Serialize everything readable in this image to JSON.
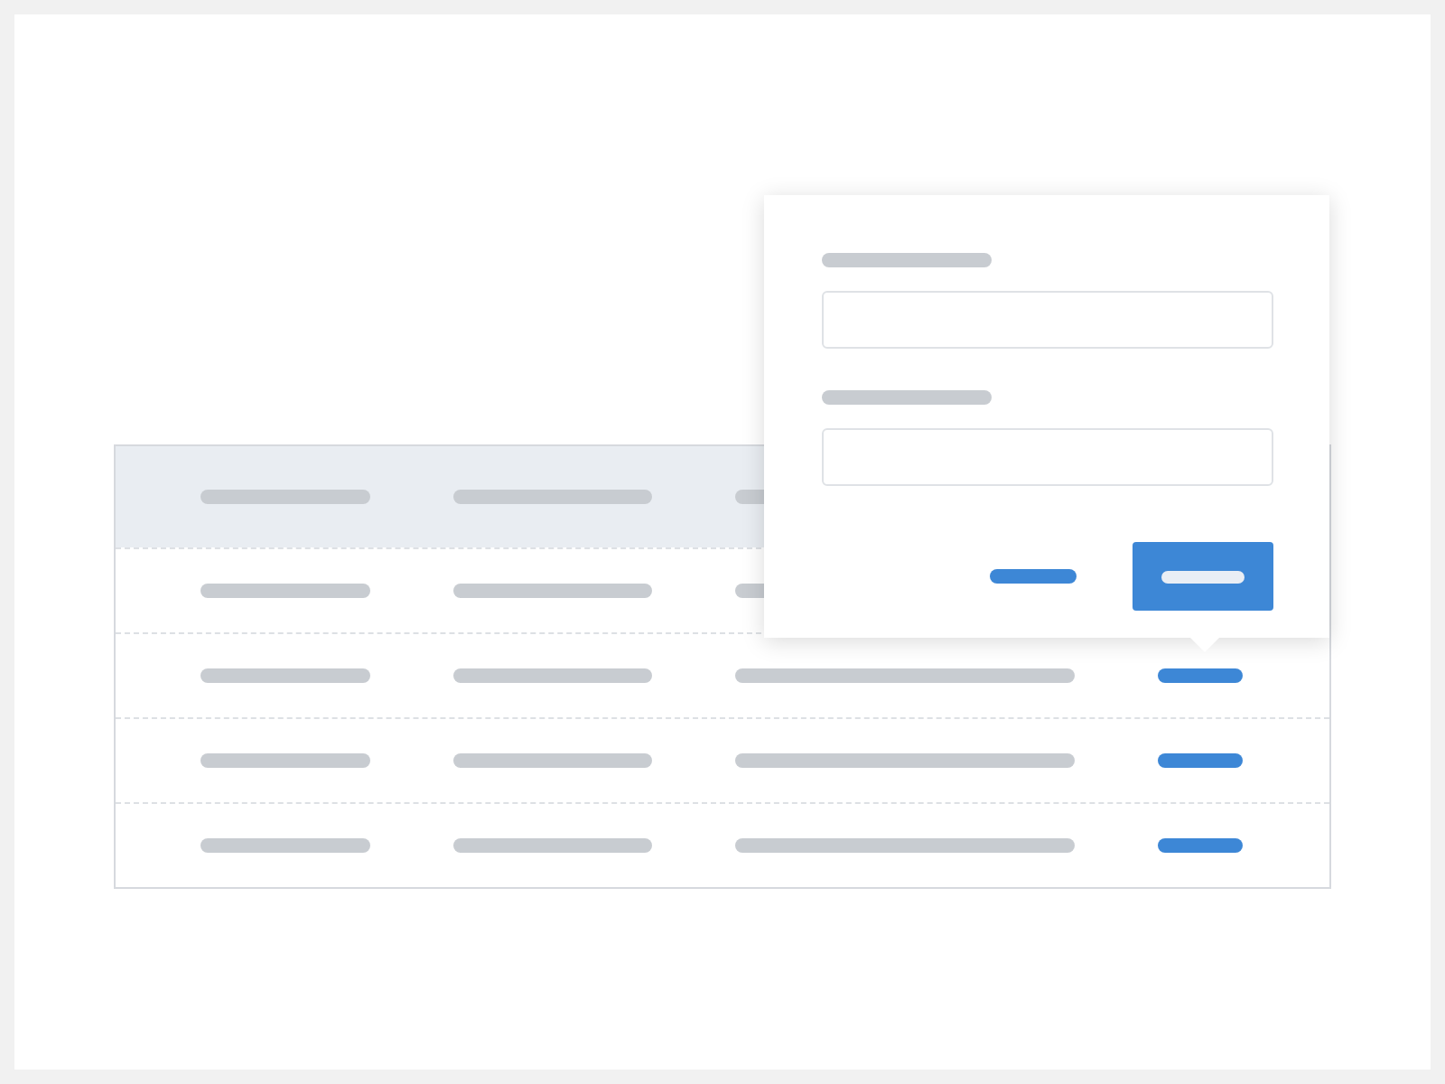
{
  "table": {
    "header": {
      "cells": [
        {
          "kind": "text"
        },
        {
          "kind": "text"
        },
        {
          "kind": "text"
        }
      ]
    },
    "rows": [
      {
        "cells": [
          {
            "kind": "text"
          },
          {
            "kind": "text"
          },
          {
            "kind": "text"
          }
        ]
      },
      {
        "cells": [
          {
            "kind": "text"
          },
          {
            "kind": "text"
          },
          {
            "kind": "text"
          },
          {
            "kind": "action"
          }
        ]
      },
      {
        "cells": [
          {
            "kind": "text"
          },
          {
            "kind": "text"
          },
          {
            "kind": "text"
          },
          {
            "kind": "action"
          }
        ]
      },
      {
        "cells": [
          {
            "kind": "text"
          },
          {
            "kind": "text"
          },
          {
            "kind": "text"
          },
          {
            "kind": "action"
          }
        ]
      }
    ]
  },
  "popover": {
    "fields": [
      {
        "kind": "input"
      },
      {
        "kind": "input"
      }
    ],
    "buttons": [
      {
        "kind": "link"
      },
      {
        "kind": "primary"
      }
    ]
  }
}
